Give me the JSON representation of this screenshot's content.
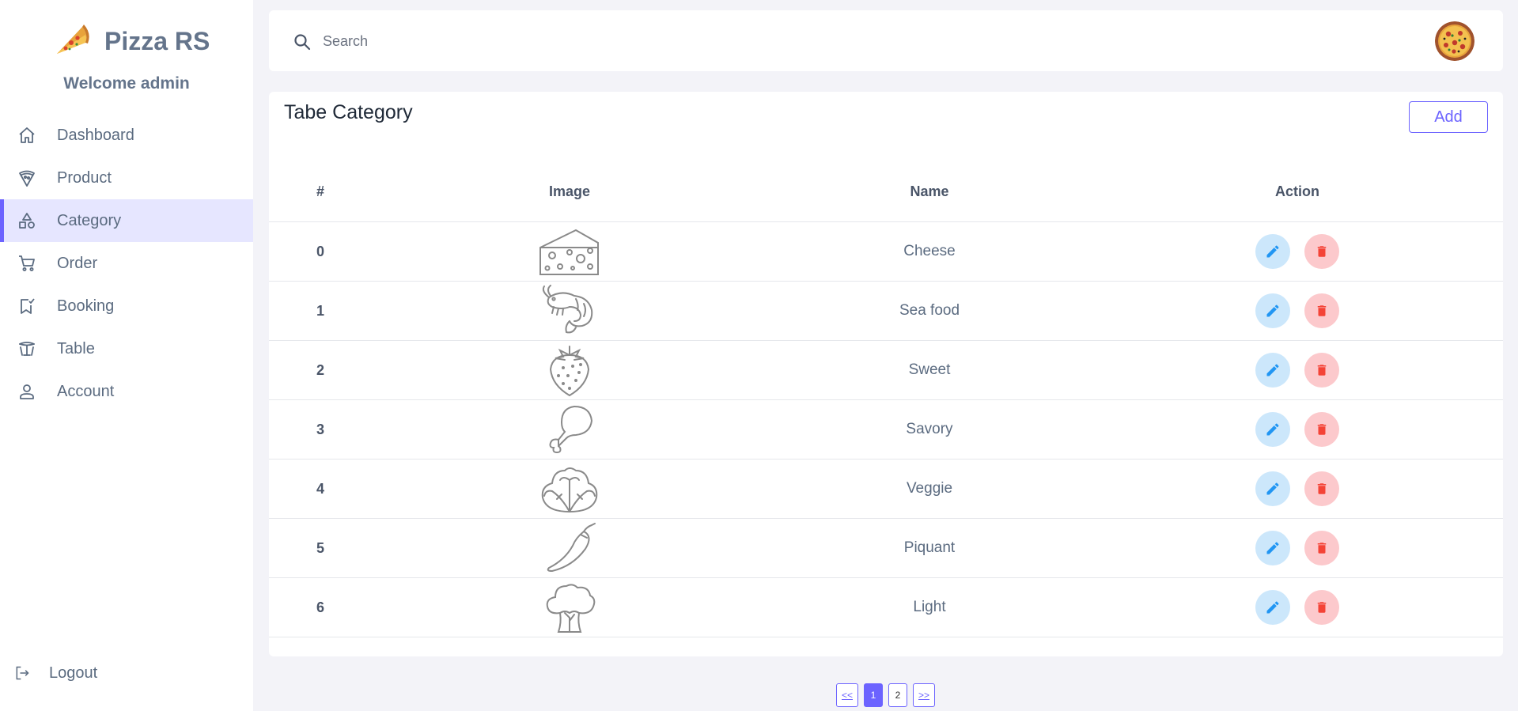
{
  "brand": {
    "name": "Pizza RS",
    "welcome": "Welcome admin"
  },
  "sidebar": {
    "items": [
      {
        "label": "Dashboard",
        "icon": "home-icon"
      },
      {
        "label": "Product",
        "icon": "pizza-slice-icon"
      },
      {
        "label": "Category",
        "icon": "shapes-icon",
        "active": true
      },
      {
        "label": "Order",
        "icon": "cart-icon"
      },
      {
        "label": "Booking",
        "icon": "bookmark-check-icon"
      },
      {
        "label": "Table",
        "icon": "table-icon"
      },
      {
        "label": "Account",
        "icon": "user-icon"
      }
    ],
    "logout": "Logout"
  },
  "search": {
    "placeholder": "Search",
    "value": ""
  },
  "card": {
    "title": "Tabe Category",
    "add_label": "Add",
    "columns": [
      "#",
      "Image",
      "Name",
      "Action"
    ],
    "rows": [
      {
        "index": "0",
        "name": "Cheese",
        "image": "cheese-icon"
      },
      {
        "index": "1",
        "name": "Sea food",
        "image": "shrimp-icon"
      },
      {
        "index": "2",
        "name": "Sweet",
        "image": "strawberry-icon"
      },
      {
        "index": "3",
        "name": "Savory",
        "image": "chicken-leg-icon"
      },
      {
        "index": "4",
        "name": "Veggie",
        "image": "lettuce-icon"
      },
      {
        "index": "5",
        "name": "Piquant",
        "image": "chili-icon"
      },
      {
        "index": "6",
        "name": "Light",
        "image": "broccoli-icon"
      }
    ]
  },
  "pagination": {
    "prev": "<<",
    "pages": [
      "1",
      "2"
    ],
    "current": "1",
    "next": ">>"
  },
  "colors": {
    "accent": "#6c63ff",
    "edit_bg": "#cce7fb",
    "edit_fg": "#2196f3",
    "delete_bg": "#fcc9cc",
    "delete_fg": "#f44336",
    "active_nav_bg": "#e6e6ff"
  }
}
